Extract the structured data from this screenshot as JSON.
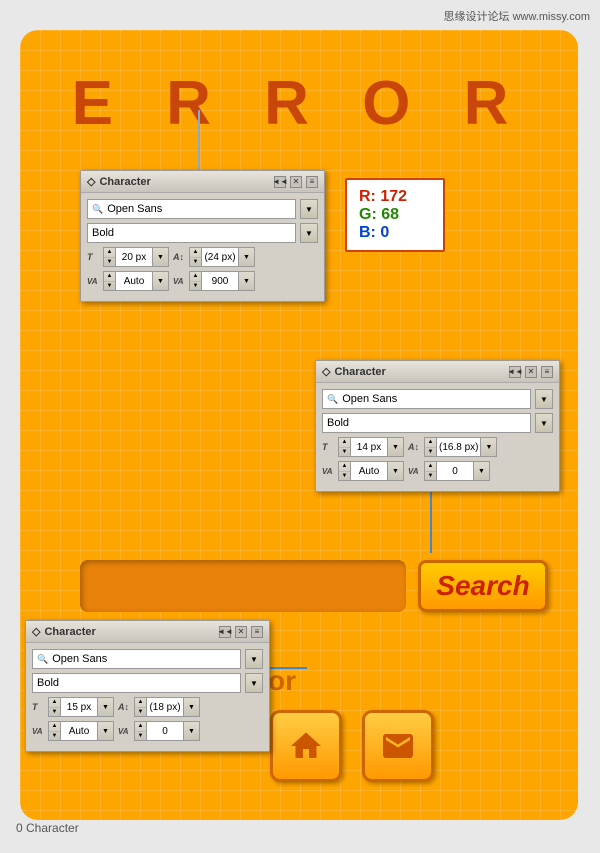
{
  "watermark": {
    "text": "思缘设计论坛 www.missy.com"
  },
  "error_title": "E  R  R  O  R",
  "rgb_box": {
    "r_label": "R: 172",
    "g_label": "G: 68",
    "b_label": "B: 0"
  },
  "char_panel_1": {
    "title": "Character",
    "font": "Open Sans",
    "style": "Bold",
    "size": "20 px",
    "leading": "(24 px)",
    "tracking": "Auto",
    "kerning": "900"
  },
  "char_panel_2": {
    "title": "Character",
    "font": "Open Sans",
    "style": "Bold",
    "size": "14 px",
    "leading": "(16.8 px)",
    "tracking": "Auto",
    "kerning": "0"
  },
  "char_panel_3": {
    "title": "Character",
    "font": "Open Sans",
    "style": "Bold",
    "size": "15 px",
    "leading": "(18 px)",
    "tracking": "Auto",
    "kerning": "0"
  },
  "search_button": "Search",
  "or_text": "or",
  "bottom_label": "0 Character",
  "icons": {
    "home": "home",
    "mail": "mail",
    "search": "search",
    "collapse": "◄◄",
    "close": "✕",
    "menu": "≡",
    "spin_up": "▲",
    "spin_down": "▼",
    "dropdown": "▼"
  }
}
